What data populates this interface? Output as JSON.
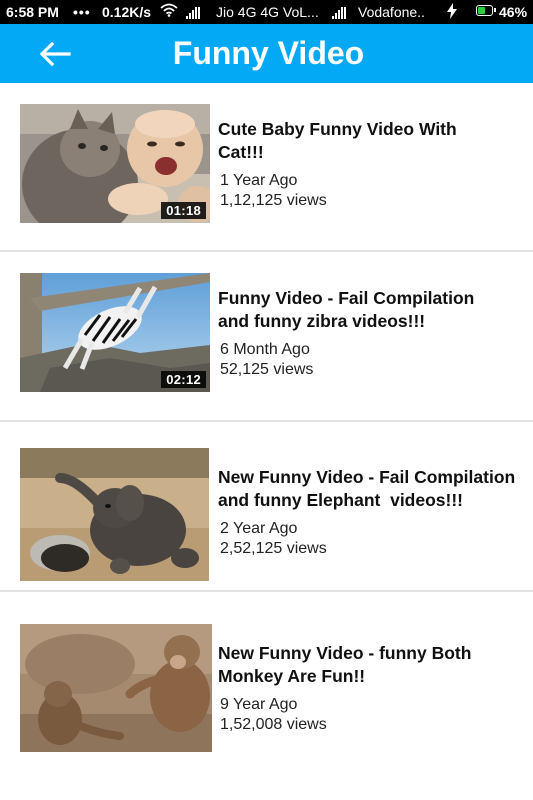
{
  "status_bar": {
    "time": "6:58 PM",
    "dots": "•••",
    "speed": "0.12K/s",
    "carrier1": "Jio 4G 4G VoL...",
    "carrier2": "Vodafone..",
    "battery": "46%",
    "battery_level": 0.46
  },
  "app_bar": {
    "title": "Funny Video",
    "back_icon": "arrow-left-icon",
    "color": "#03a9f4"
  },
  "videos": [
    {
      "title": "Cute Baby Funny Video With\nCat!!!",
      "time_ago": "1 Year Ago",
      "views": "1,12,125 views",
      "duration": "01:18"
    },
    {
      "title": "Funny Video - Fail Compilation\nand funny zibra videos!!!",
      "time_ago": "6 Month Ago",
      "views": "52,125 views",
      "duration": "02:12"
    },
    {
      "title": "New Funny Video - Fail Compilation\nand funny Elephant  videos!!!",
      "time_ago": "2 Year Ago",
      "views": "2,52,125 views",
      "duration": ""
    },
    {
      "title": "New Funny Video - funny Both\nMonkey Are Fun!!",
      "time_ago": "9 Year Ago",
      "views": "1,52,008 views",
      "duration": ""
    }
  ]
}
